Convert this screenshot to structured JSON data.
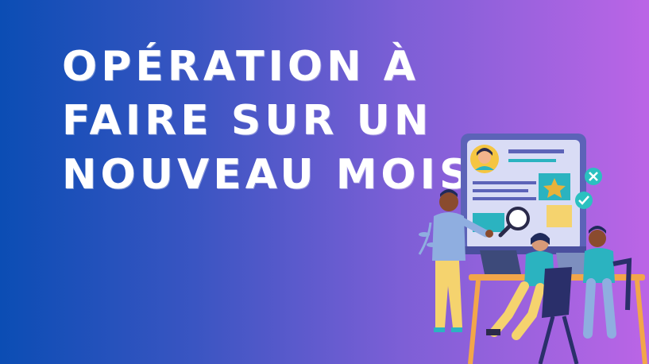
{
  "banner": {
    "title_lines": [
      "Opération à",
      "faire sur un",
      "nouveau mois"
    ]
  },
  "colors": {
    "gradient_start": "#0b4db4",
    "gradient_end": "#bb65e6",
    "title": "#ffffff"
  },
  "illustration": {
    "icons": [
      "avatar-icon",
      "star-icon",
      "magnifier-icon",
      "close-icon",
      "check-icon",
      "laptop-icon"
    ]
  }
}
